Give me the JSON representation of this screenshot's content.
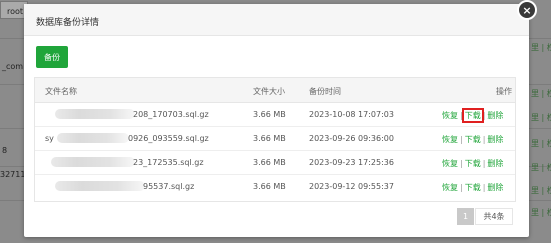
{
  "background": {
    "root_label": "root",
    "left_texts": [
      "_com",
      "8",
      "32711"
    ],
    "right_texts": [
      "里 | 权",
      "里 | 权",
      "里 | 权",
      "里 | 权",
      "里 | 权",
      "里 | 权",
      "里 | 权"
    ]
  },
  "dialog": {
    "title": "数据库备份详情",
    "close_glyph": "×",
    "backup_button": "备份",
    "table": {
      "headers": {
        "filename": "文件名称",
        "size": "文件大小",
        "time": "备份时间",
        "actions": "操作"
      },
      "rows": [
        {
          "filename_prefix": "",
          "filename_suffix": "208_170703.sql.gz",
          "size": "3.66 MB",
          "time": "2023-10-08 17:07:03"
        },
        {
          "filename_prefix": "sy",
          "filename_suffix": "0926_093559.sql.gz",
          "size": "3.66 MB",
          "time": "2023-09-26 09:36:00"
        },
        {
          "filename_prefix": "",
          "filename_suffix": "23_172535.sql.gz",
          "size": "3.66 MB",
          "time": "2023-09-23 17:25:36"
        },
        {
          "filename_prefix": "",
          "filename_suffix": "95537.sql.gz",
          "size": "3.66 MB",
          "time": "2023-09-12 09:55:37"
        }
      ],
      "actions": {
        "restore": "恢复",
        "download": "下载",
        "delete": "删除",
        "separator": "|"
      }
    },
    "pagination": {
      "current_page": "1",
      "total": "共4条"
    }
  },
  "colors": {
    "accent": "#20a53a",
    "highlight": "#e02020"
  }
}
